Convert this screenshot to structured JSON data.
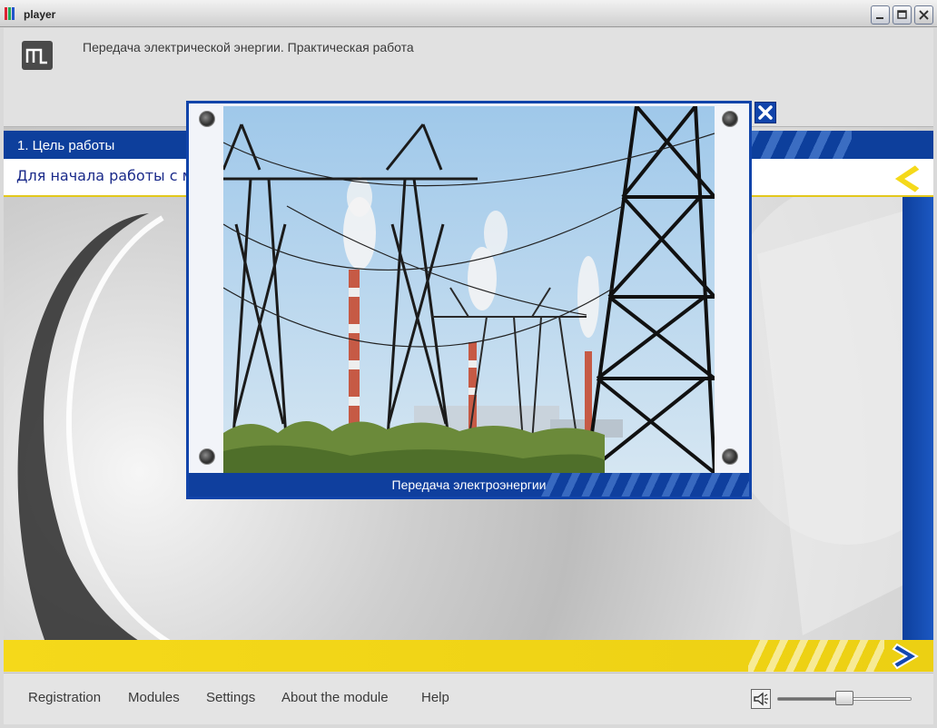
{
  "window": {
    "title": "player",
    "controls": [
      "minimize",
      "maximize",
      "close"
    ]
  },
  "header": {
    "course_title": "Передача электрической энергии. Практическая работа"
  },
  "section": {
    "title": "1. Цель работы",
    "instruction": "Для начала работы с материалом нажмите кнопку «Далее»"
  },
  "popup": {
    "caption": "Передача электроэнергии"
  },
  "footer": {
    "menu": [
      "Registration",
      "Modules",
      "Settings",
      "About the module",
      "Help"
    ],
    "volume_level": 0.5
  },
  "colors": {
    "primary_blue": "#0d3f9c",
    "accent_yellow": "#f5d91a",
    "instruction_text": "#1a2a8a"
  }
}
